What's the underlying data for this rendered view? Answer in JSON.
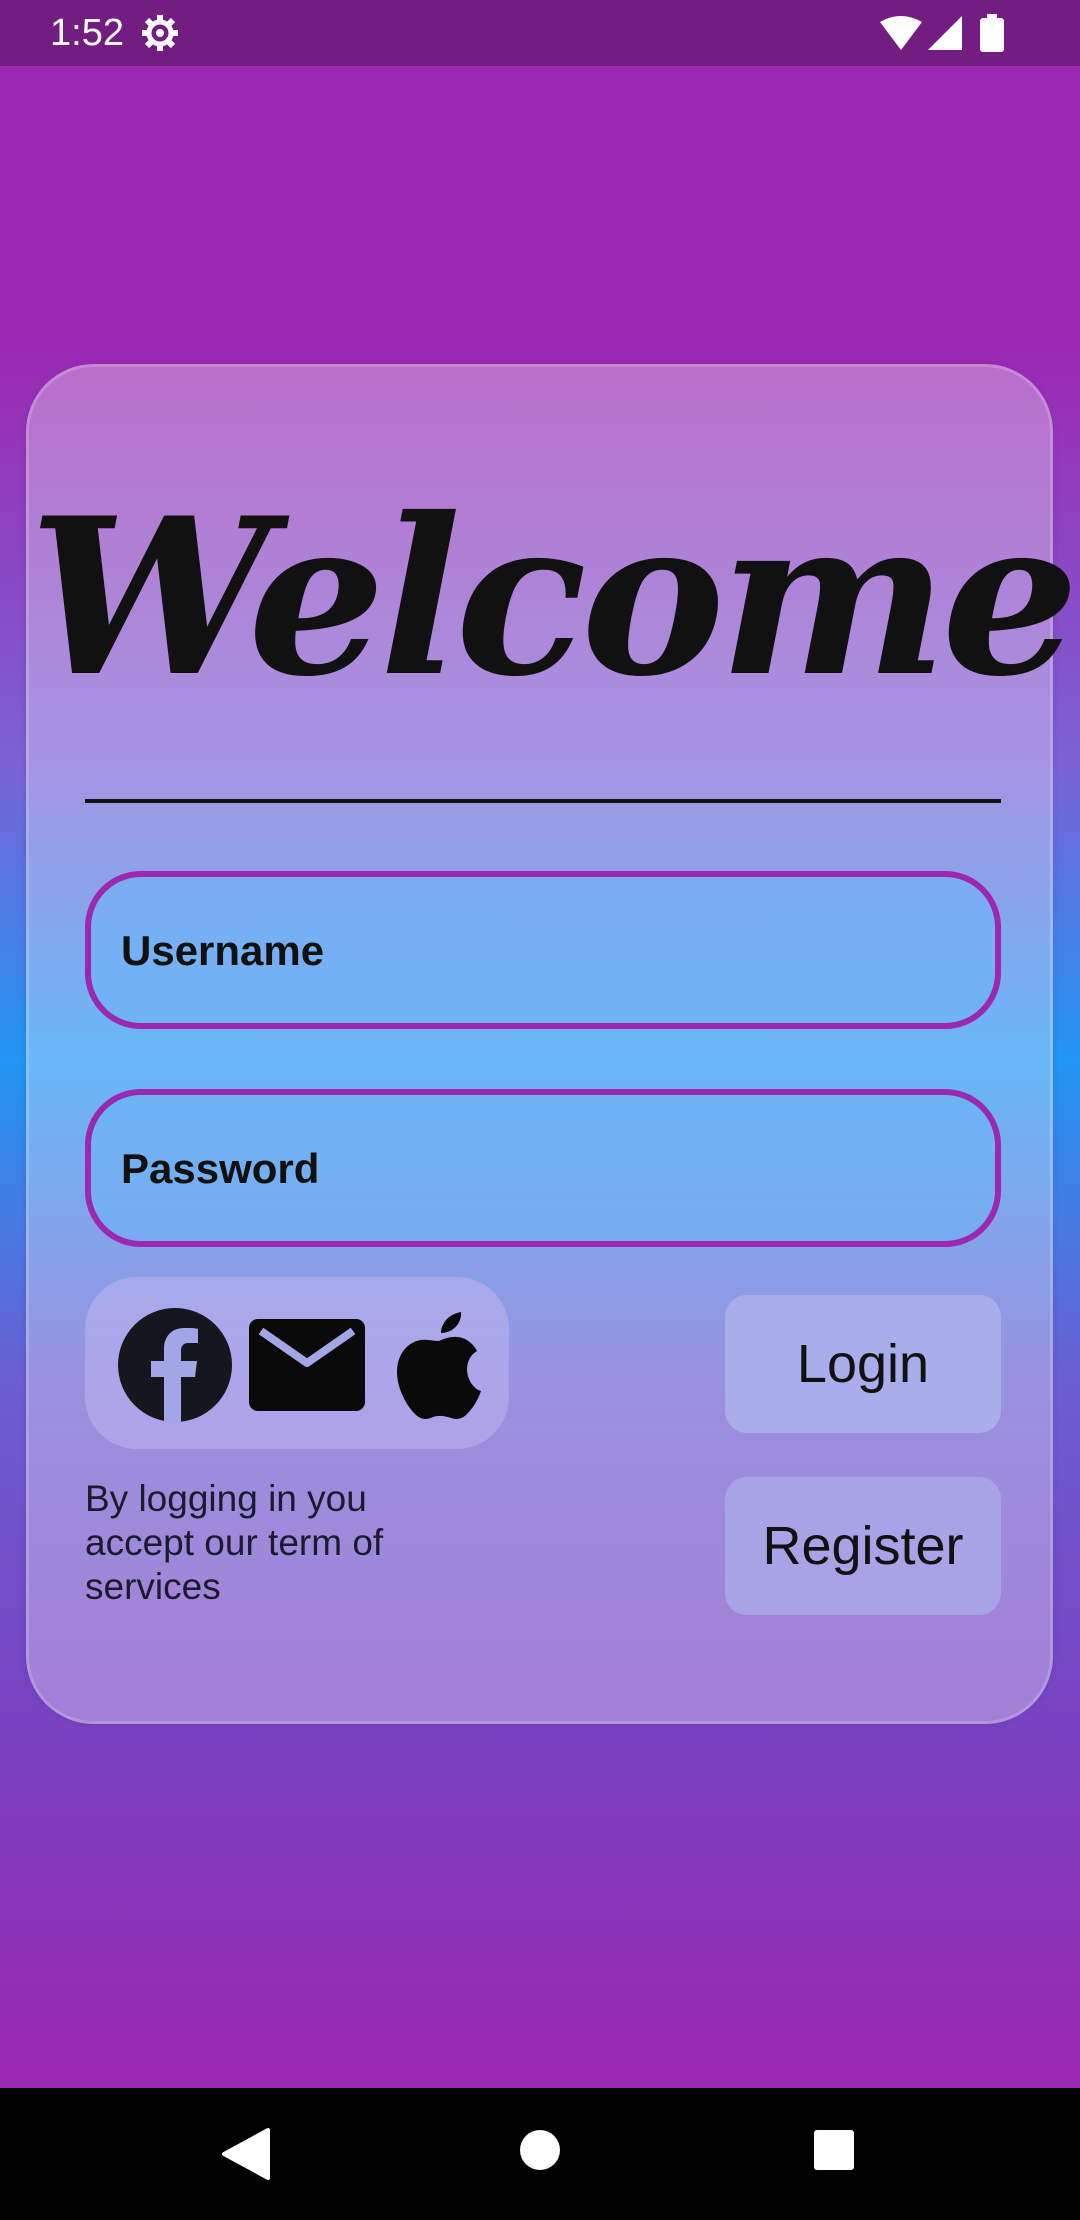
{
  "status_bar": {
    "time": "1:52",
    "icons": [
      "gear-icon",
      "wifi-icon",
      "cell-signal-icon",
      "battery-icon"
    ]
  },
  "card": {
    "title": "Welcome",
    "username_placeholder": "Username",
    "password_placeholder": "Password",
    "social_icons": [
      "facebook-icon",
      "mail-icon",
      "apple-icon"
    ],
    "login_label": "Login",
    "register_label": "Register",
    "terms_text": "By logging in you accept our term of services"
  },
  "colors": {
    "accent": "#9c27b0",
    "blue": "#2196f3",
    "status_bar": "#731c82"
  },
  "nav_bar": {
    "icons": [
      "back-icon",
      "home-icon",
      "recents-icon"
    ]
  }
}
